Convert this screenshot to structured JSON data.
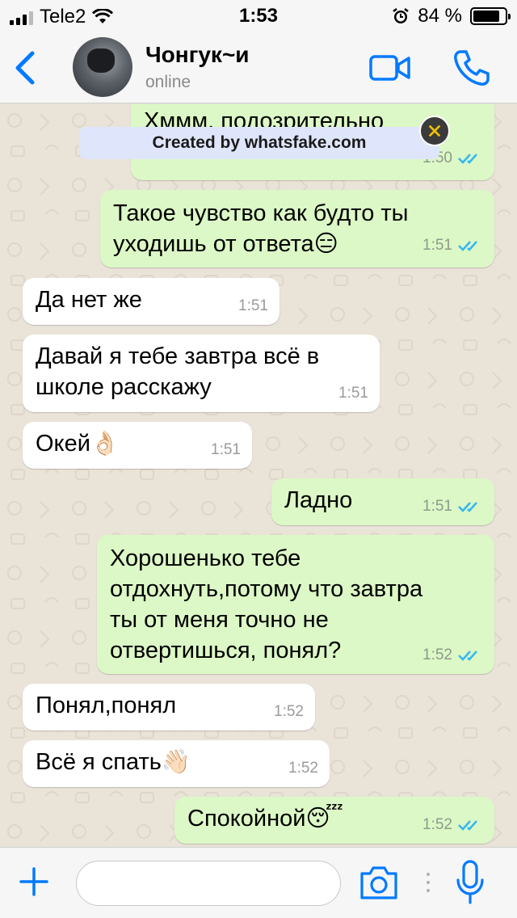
{
  "status_bar": {
    "carrier": "Tele2",
    "time": "1:53",
    "battery": "84 %",
    "battery_fraction": 0.84
  },
  "header": {
    "contact_name": "Чонгук~и",
    "status": "online"
  },
  "watermark": {
    "text": "Created by whatsfake.com"
  },
  "messages": [
    {
      "direction": "out",
      "text": "Хммм, подозрительно",
      "time": "1:50"
    },
    {
      "direction": "out",
      "text": "Такое чувство как будто ты\nуходишь от ответа😑",
      "time": "1:51"
    },
    {
      "direction": "in",
      "text": "Да нет же",
      "time": "1:51"
    },
    {
      "direction": "in",
      "text": "Давай я тебе завтра всё в\nшколе расскажу",
      "time": "1:51"
    },
    {
      "direction": "in",
      "text": "Окей👌🏻",
      "time": "1:51"
    },
    {
      "direction": "out",
      "text": "Ладно",
      "time": "1:51"
    },
    {
      "direction": "out",
      "text": "Хорошенько тебе\nотдохнуть,потому что завтра\nты от меня точно не\nотвертишься, понял?",
      "time": "1:52"
    },
    {
      "direction": "in",
      "text": "Понял,понял",
      "time": "1:52"
    },
    {
      "direction": "in",
      "text": "Всё я спать👋🏻",
      "time": "1:52"
    },
    {
      "direction": "out",
      "text": "Спокойной😴",
      "time": "1:52"
    }
  ],
  "input": {
    "placeholder": ""
  },
  "colors": {
    "accent": "#007aff",
    "outgoing_bubble": "#dcf8c6",
    "incoming_bubble": "#ffffff",
    "read_ticks": "#34b7f1"
  }
}
